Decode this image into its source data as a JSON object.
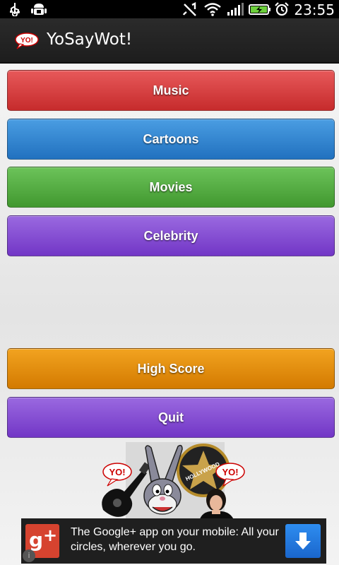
{
  "status_bar": {
    "time": "23:55",
    "icons": [
      "usb-icon",
      "android-debug-icon",
      "mute-icon",
      "wifi-icon",
      "signal-icon",
      "battery-icon",
      "alarm-icon"
    ]
  },
  "app_bar": {
    "logo_text": "YO!",
    "title": "YoSayWot!"
  },
  "menu": {
    "categories": [
      {
        "label": "Music",
        "color": "#d33b3c"
      },
      {
        "label": "Cartoons",
        "color": "#2f82d0"
      },
      {
        "label": "Movies",
        "color": "#52ad3f"
      },
      {
        "label": "Celebrity",
        "color": "#8450d3"
      }
    ],
    "high_score_label": "High Score",
    "high_score_color": "#e48c0e",
    "quit_label": "Quit",
    "quit_color": "#8450d3"
  },
  "artwork": {
    "bubble_left": "YO!",
    "bubble_right": "YO!",
    "star_text": "HOLLYWOOD"
  },
  "ad": {
    "text": "The Google+ app on your mobile: All your circles, wherever you go.",
    "icon": "google-plus-icon",
    "action_icon": "download-arrow-icon"
  }
}
